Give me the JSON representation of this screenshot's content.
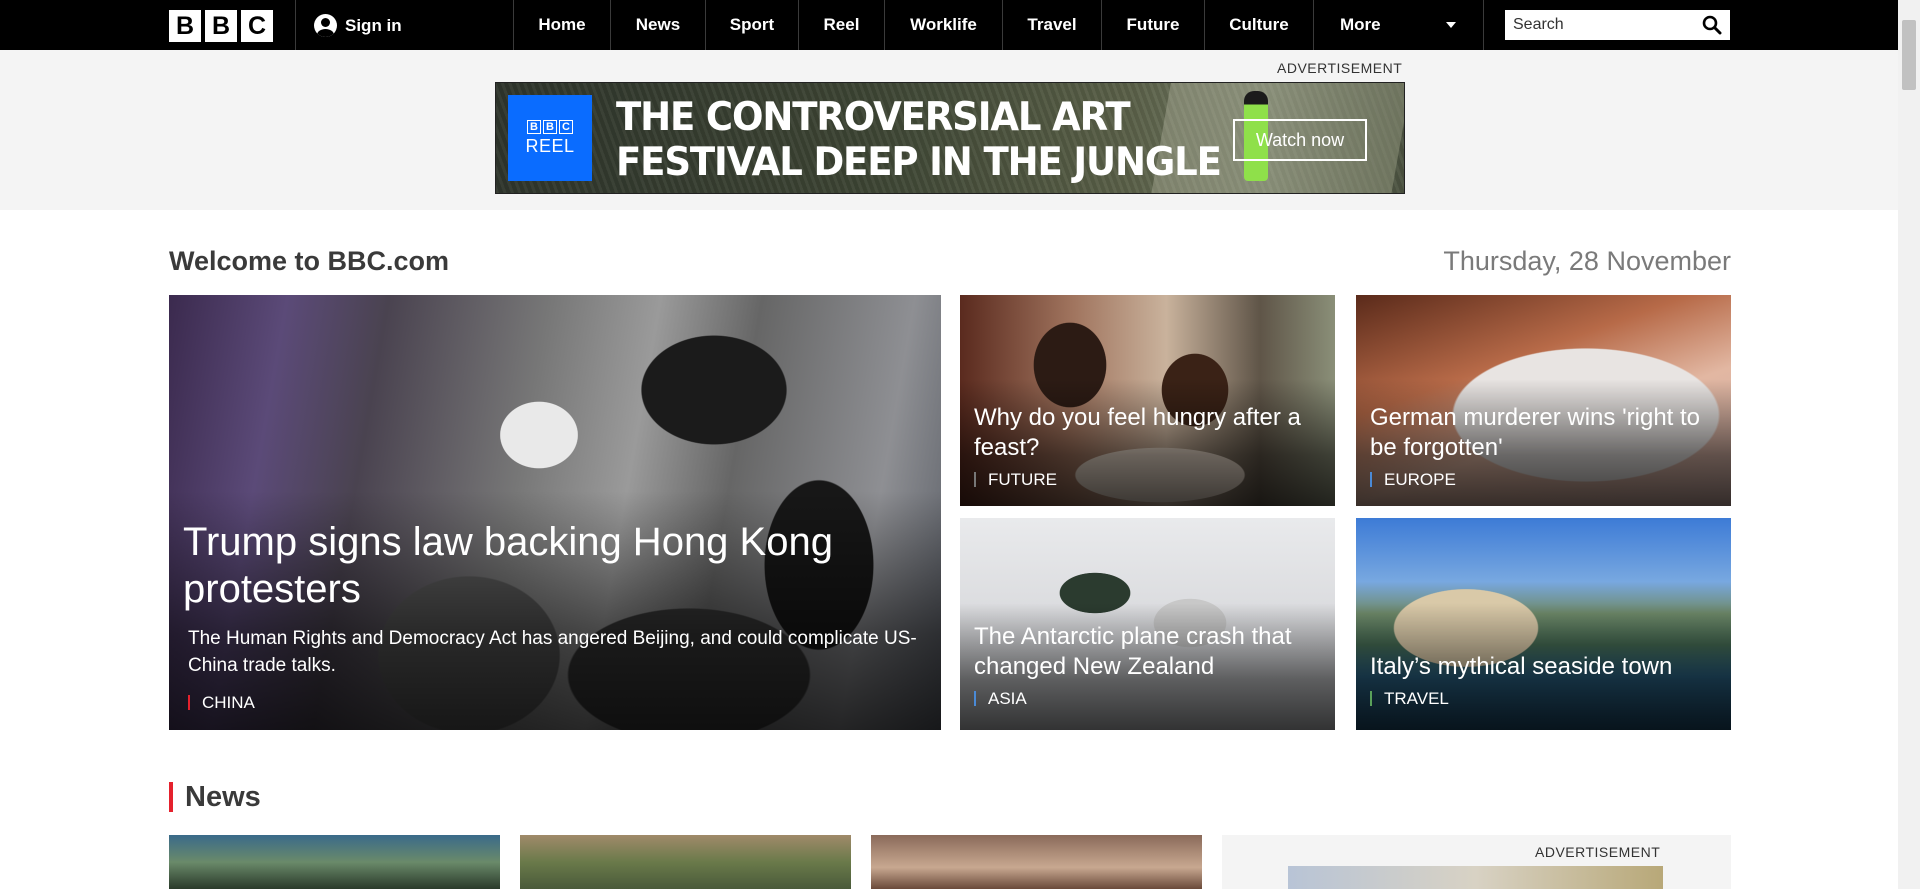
{
  "header": {
    "logo_letters": [
      "B",
      "B",
      "C"
    ],
    "signin_label": "Sign in",
    "nav": [
      "Home",
      "News",
      "Sport",
      "Reel",
      "Worklife",
      "Travel",
      "Future",
      "Culture",
      "More"
    ],
    "search_placeholder": "Search"
  },
  "ad": {
    "label": "ADVERTISEMENT",
    "brand_letters": [
      "B",
      "B",
      "C"
    ],
    "brand_sub": "REEL",
    "headline_line1": "THE CONTROVERSIAL ART",
    "headline_line2": "FESTIVAL DEEP IN THE JUNGLE",
    "cta": "Watch now"
  },
  "welcome": {
    "title": "Welcome to BBC.com",
    "date": "Thursday, 28 November"
  },
  "hero": {
    "title": "Trump signs law backing Hong Kong protesters",
    "description": "The Human Rights and Democracy Act has angered Beijing, and could complicate US-China trade talks.",
    "tag": "CHINA"
  },
  "tiles": [
    {
      "title": "Why do you feel hungry after a feast?",
      "tag": "FUTURE"
    },
    {
      "title": "German murderer wins 'right to be forgotten'",
      "tag": "EUROPE"
    },
    {
      "title": "The Antarctic plane crash that changed New Zealand",
      "tag": "ASIA"
    },
    {
      "title": "Italy’s mythical seaside town",
      "tag": "TRAVEL"
    }
  ],
  "news": {
    "heading": "News",
    "ad_label": "ADVERTISEMENT"
  },
  "colors": {
    "nav_bg": "#000000",
    "accent_red": "#e5212d",
    "reel_blue": "#0a6cff"
  }
}
